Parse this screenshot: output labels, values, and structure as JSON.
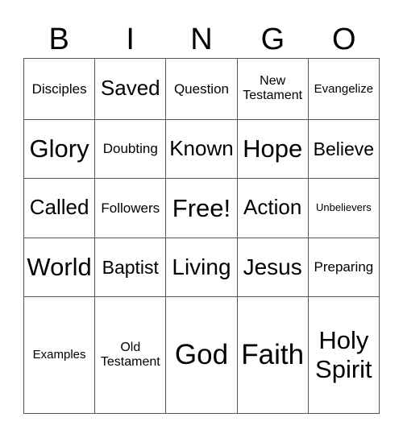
{
  "header": [
    "B",
    "I",
    "N",
    "G",
    "O"
  ],
  "rows": [
    [
      "Disciples",
      "Saved",
      "Question",
      "New Testament",
      "Evangelize"
    ],
    [
      "Glory",
      "Doubting",
      "Known",
      "Hope",
      "Believe"
    ],
    [
      "Called",
      "Followers",
      "Free!",
      "Action",
      "Unbelievers"
    ],
    [
      "World",
      "Baptist",
      "Living",
      "Jesus",
      "Preparing"
    ],
    [
      "Examples",
      "Old Testament",
      "God",
      "Faith",
      "Holy Spirit"
    ]
  ]
}
